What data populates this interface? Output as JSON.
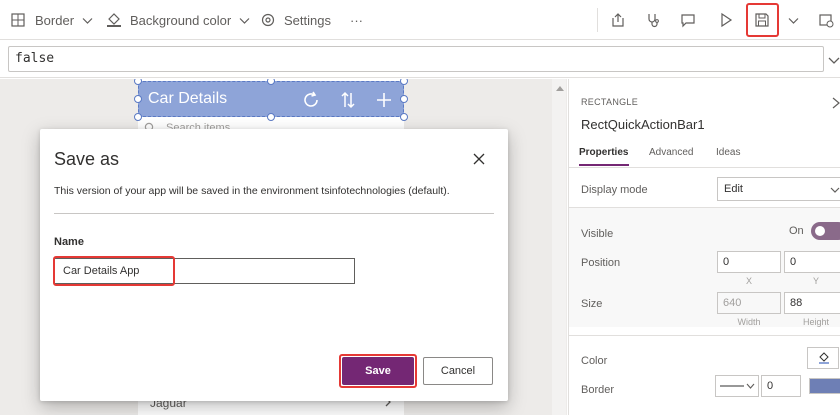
{
  "toolbar": {
    "border_label": "Border",
    "background_label": "Background color",
    "settings_label": "Settings",
    "more_label": "···"
  },
  "formula": {
    "value": "false"
  },
  "canvas": {
    "header_title": "Car Details",
    "search_placeholder": "Search items",
    "list_item": "Jaguar"
  },
  "dialog": {
    "title": "Save as",
    "description": "This version of your app will be saved in the environment tsinfotechnologies (default).",
    "name_label": "Name",
    "name_value": "Car Details App",
    "save_label": "Save",
    "cancel_label": "Cancel"
  },
  "panel": {
    "type": "RECTANGLE",
    "name": "RectQuickActionBar1",
    "tabs": [
      {
        "label": "Properties"
      },
      {
        "label": "Advanced"
      },
      {
        "label": "Ideas"
      }
    ],
    "display_mode_label": "Display mode",
    "display_mode_value": "Edit",
    "visible_label": "Visible",
    "visible_value": "On",
    "position_label": "Position",
    "x_value": "0",
    "y_value": "0",
    "x_sub": "X",
    "y_sub": "Y",
    "size_label": "Size",
    "width_value": "640",
    "height_value": "88",
    "width_sub": "Width",
    "height_sub": "Height",
    "color_label": "Color",
    "border_label": "Border",
    "border_width_value": "0"
  },
  "colors": {
    "accent": "#742774",
    "header_bar": "#8ea4d8",
    "highlight": "#e53935"
  }
}
